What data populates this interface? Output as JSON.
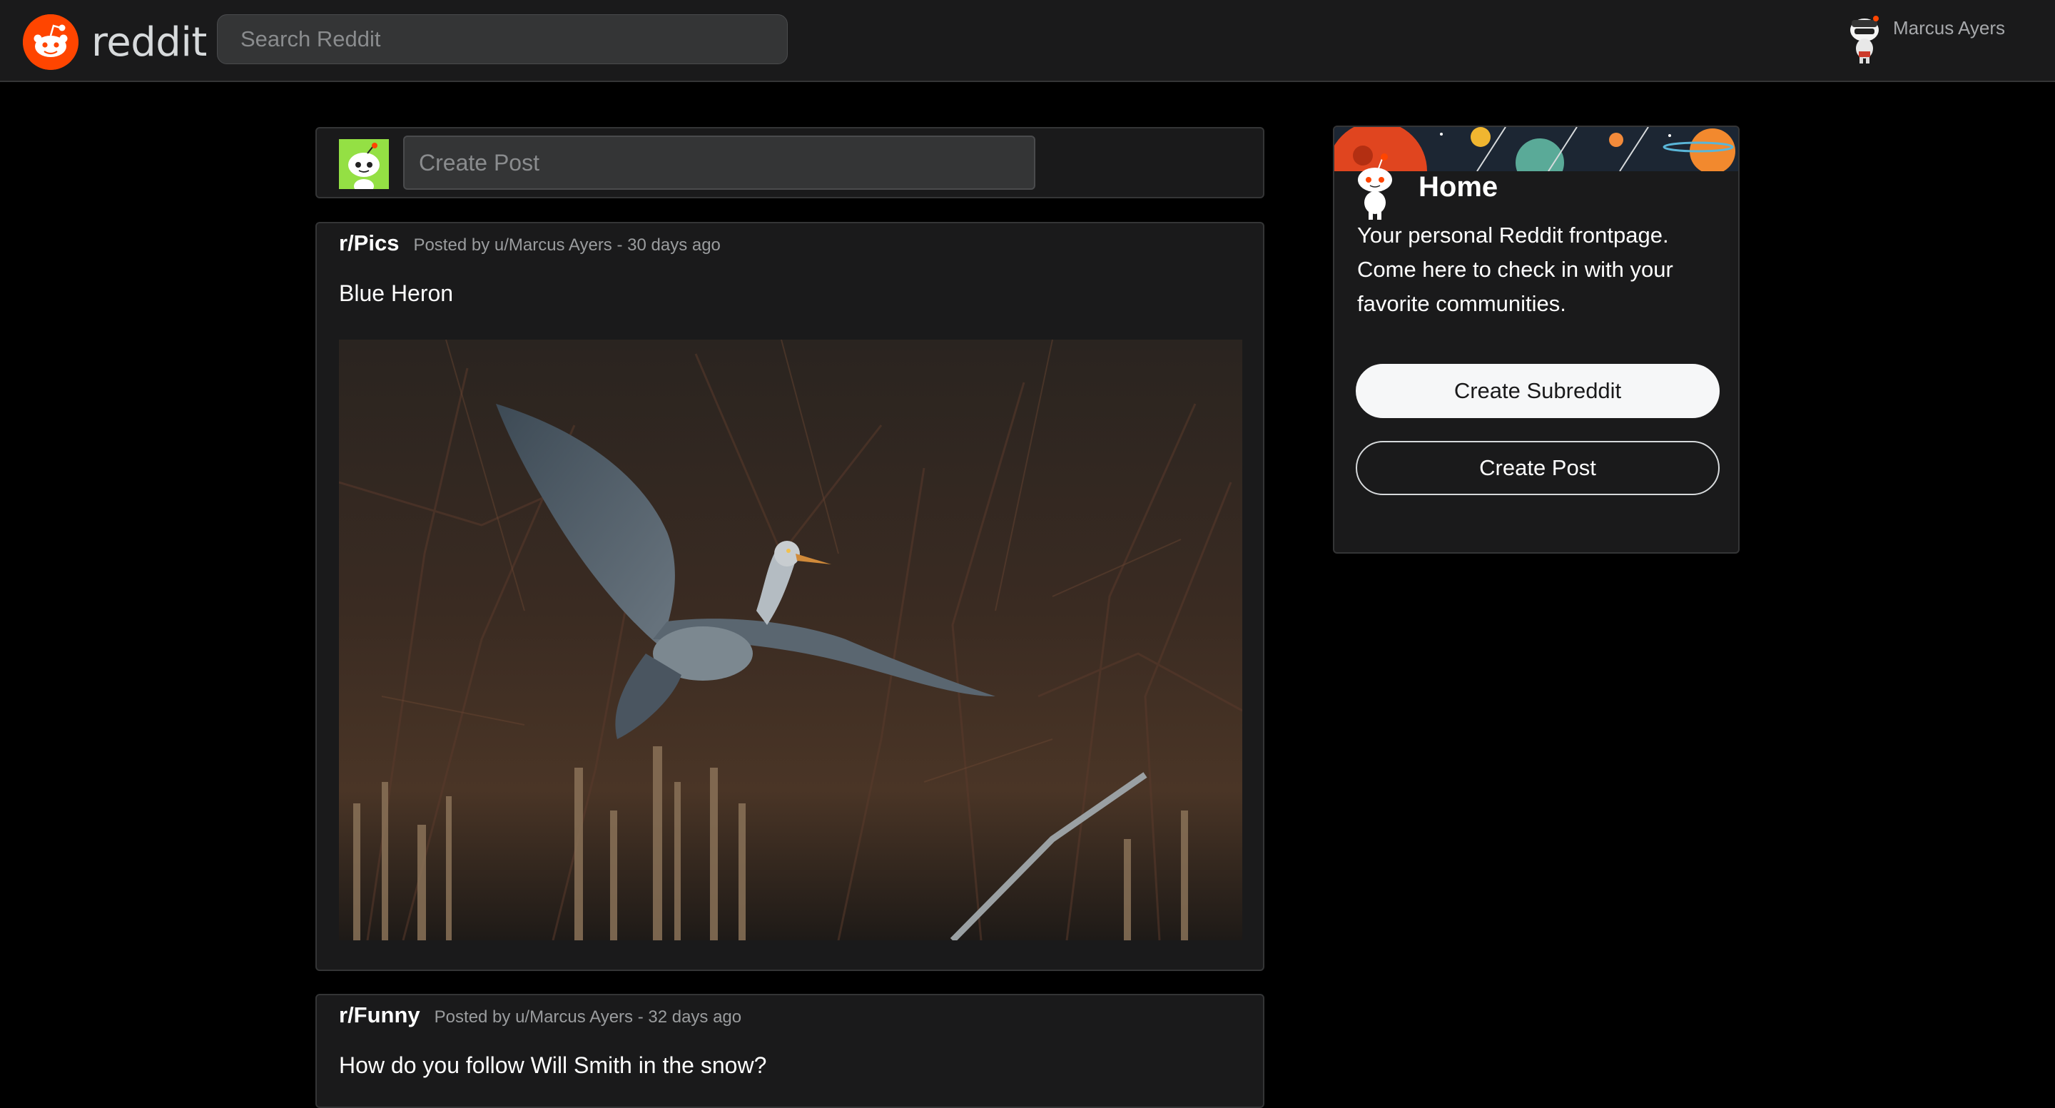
{
  "header": {
    "logo_text": "reddit",
    "logo_icon": "reddit-snoo-icon",
    "search_placeholder": "Search Reddit",
    "user_name": "Marcus Ayers",
    "user_avatar_icon": "snoo-avatar-icon"
  },
  "create_bar": {
    "placeholder": "Create Post",
    "avatar_icon": "snoo-avatar-icon"
  },
  "posts": [
    {
      "subreddit": "r/Pics",
      "byline": "Posted by u/Marcus Ayers - 30 days ago",
      "title": "Blue Heron",
      "image": "blue-heron-photo"
    },
    {
      "subreddit": "r/Funny",
      "byline": "Posted by u/Marcus Ayers - 32 days ago",
      "title": "How do you follow Will Smith in the snow?"
    }
  ],
  "sidebar": {
    "home_title": "Home",
    "home_description": "Your personal Reddit frontpage. Come here to check in with your favorite communities.",
    "create_subreddit_label": "Create Subreddit",
    "create_post_label": "Create Post"
  },
  "colors": {
    "brand": "#ff4500",
    "background": "#000000",
    "card": "#1a1a1b",
    "border": "#343536"
  }
}
